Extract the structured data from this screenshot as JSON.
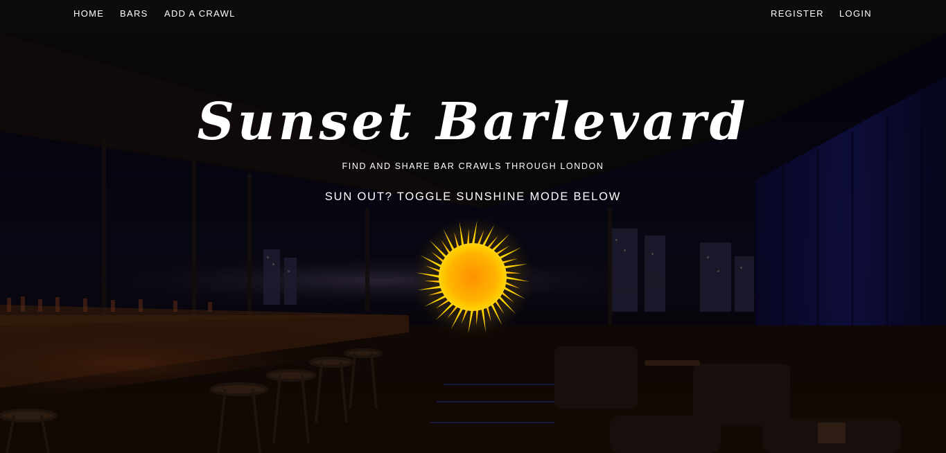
{
  "nav": {
    "left_links": [
      {
        "label": "HOME"
      },
      {
        "label": "BARS"
      },
      {
        "label": "ADD A CRAWL"
      }
    ],
    "right_links": [
      {
        "label": "REGISTER"
      },
      {
        "label": "LOGIN"
      }
    ]
  },
  "hero": {
    "title": "Sunset Barlevard",
    "subtitle": "FIND AND SHARE BAR CRAWLS THROUGH LONDON",
    "prompt": "SUN OUT? TOGGLE SUNSHINE MODE BELOW",
    "toggle_icon": "sun-icon"
  },
  "colors": {
    "nav_background": "#0c0c0c",
    "text": "#ffffff",
    "sun_core": "#ff9a00",
    "sun_rays": "#ffd400"
  }
}
